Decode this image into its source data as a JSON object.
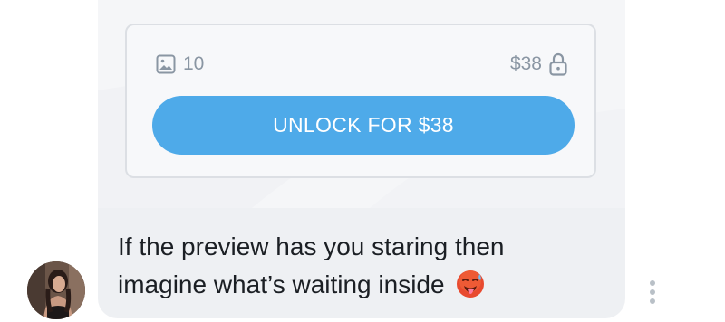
{
  "media": {
    "icon": "image-icon",
    "count": "10"
  },
  "price": {
    "label": "$38",
    "icon": "lock-icon"
  },
  "unlock_button": {
    "label": "UNLOCK FOR $38",
    "color": "#4eaae9"
  },
  "message": {
    "text": "If the preview has you staring then imagine what’s waiting inside",
    "emoji": "hot-face-emoji"
  },
  "sender": {
    "avatar_icon": "avatar"
  },
  "more_menu": {
    "icon": "more-vertical-icon"
  }
}
